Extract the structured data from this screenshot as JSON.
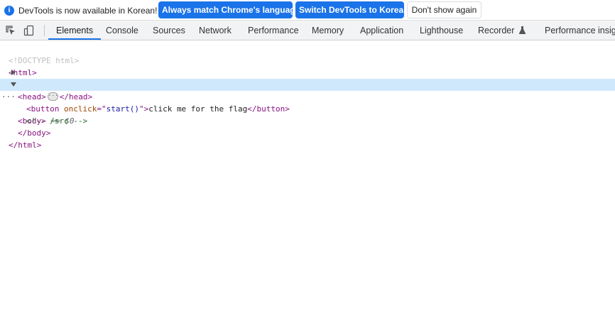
{
  "infobar": {
    "message": "DevTools is now available in Korean!",
    "button_match": "Always match Chrome's language",
    "button_switch": "Switch DevTools to Korean",
    "button_dismiss": "Don't show again",
    "accent": "#1a73e8"
  },
  "tabbar": {
    "tabs": [
      "Elements",
      "Console",
      "Sources",
      "Network",
      "Performance",
      "Memory",
      "Application",
      "Lighthouse",
      "Recorder",
      "Performance insights"
    ],
    "active": "Elements",
    "recorder_icon": "flask-icon"
  },
  "dom": {
    "doctype": "<!DOCTYPE html>",
    "html_open": "<html>",
    "head_open": "<head>",
    "head_close": "</head>",
    "body_open": "<body>",
    "selected_marker": "== $0",
    "button_open_start": "<button ",
    "button_attr_name": "onclick",
    "button_attr_eq": "=\"",
    "button_attr_value": "start()",
    "button_attr_end": "\">",
    "button_text": "click me for the flag",
    "button_close": "</button>",
    "comment": "<!-- /src -->",
    "body_close": "</body>",
    "html_close": "</html>"
  }
}
